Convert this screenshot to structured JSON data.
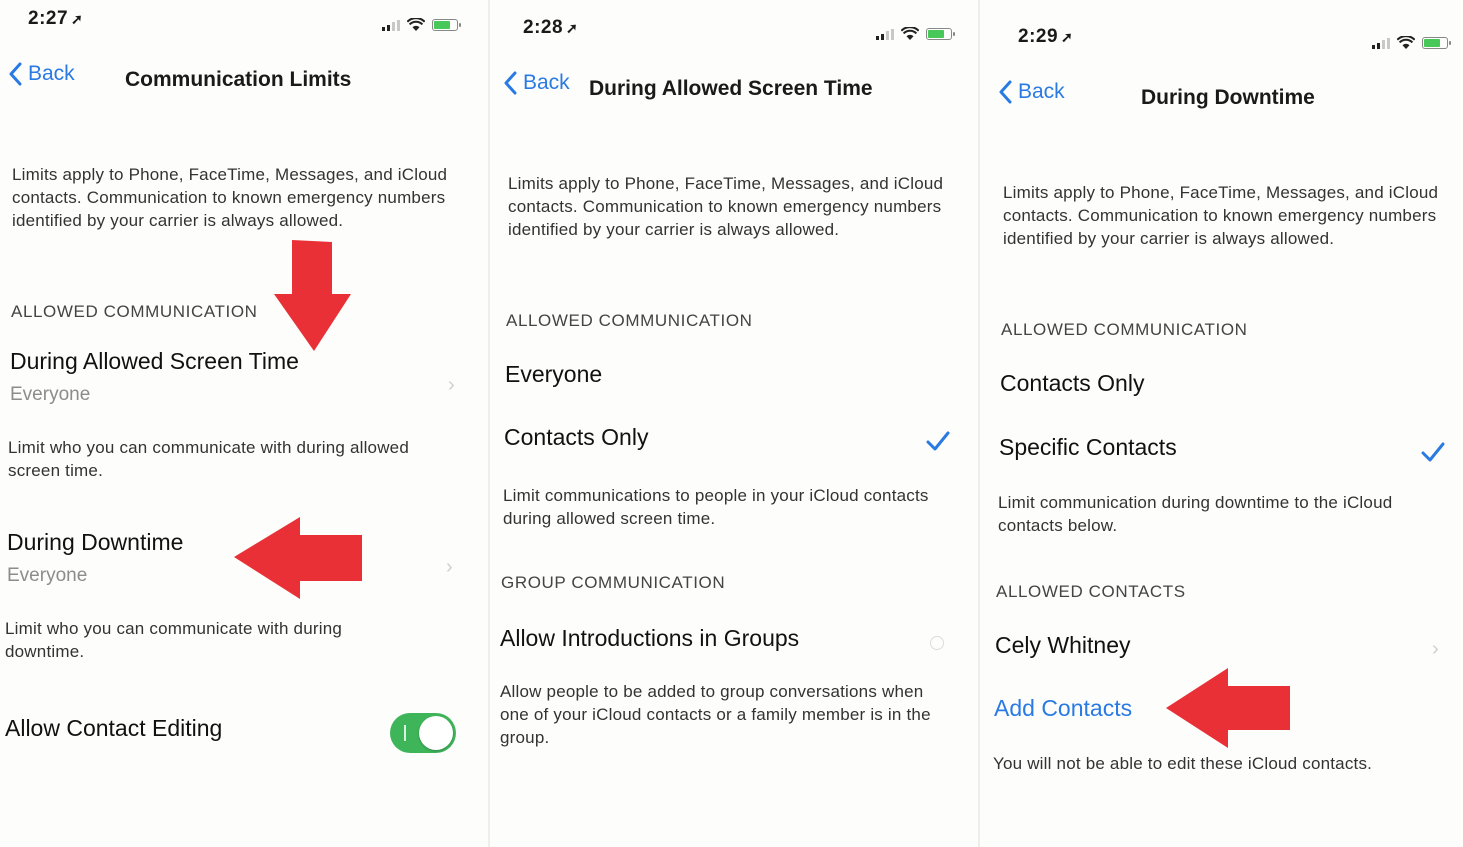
{
  "colors": {
    "accent": "#2a7ae4",
    "toggle_on": "#3fb55a",
    "annotation_arrow": "#e8252b"
  },
  "screens": [
    {
      "time": "2:27",
      "back_label": "Back",
      "title": "Communication Limits",
      "description": "Limits apply to Phone, FaceTime, Messages, and iCloud contacts. Communication to known emergency numbers identified by your carrier is always allowed.",
      "section_allowed": "ALLOWED COMMUNICATION",
      "screen_time": {
        "title": "During Allowed Screen Time",
        "value": "Everyone",
        "footer": "Limit who you can communicate with during allowed screen time."
      },
      "downtime": {
        "title": "During Downtime",
        "value": "Everyone",
        "footer": "Limit who you can communicate with during downtime."
      },
      "contact_editing": {
        "label": "Allow Contact Editing",
        "toggle_on": true
      }
    },
    {
      "time": "2:28",
      "back_label": "Back",
      "title": "During Allowed Screen Time",
      "description": "Limits apply to Phone, FaceTime, Messages, and iCloud contacts. Communication to known emergency numbers identified by your carrier is always allowed.",
      "section_allowed": "ALLOWED COMMUNICATION",
      "options": [
        "Everyone",
        "Contacts Only"
      ],
      "selected": "Contacts Only",
      "options_footer": "Limit communications to people in your iCloud contacts during allowed screen time.",
      "section_group": "GROUP COMMUNICATION",
      "group_option": "Allow Introductions in Groups",
      "group_footer": "Allow people to be added to group conversations when one of your iCloud contacts or a family member is in the group."
    },
    {
      "time": "2:29",
      "back_label": "Back",
      "title": "During Downtime",
      "description": "Limits apply to Phone, FaceTime, Messages, and iCloud contacts. Communication to known emergency numbers identified by your carrier is always allowed.",
      "section_allowed": "ALLOWED COMMUNICATION",
      "options": [
        "Contacts Only",
        "Specific Contacts"
      ],
      "selected": "Specific Contacts",
      "options_footer": "Limit communication during downtime to the iCloud contacts below.",
      "section_contacts": "ALLOWED CONTACTS",
      "contacts": [
        "Cely Whitney"
      ],
      "add_contacts": "Add Contacts",
      "contacts_footer": "You will not be able to edit these iCloud contacts."
    }
  ]
}
